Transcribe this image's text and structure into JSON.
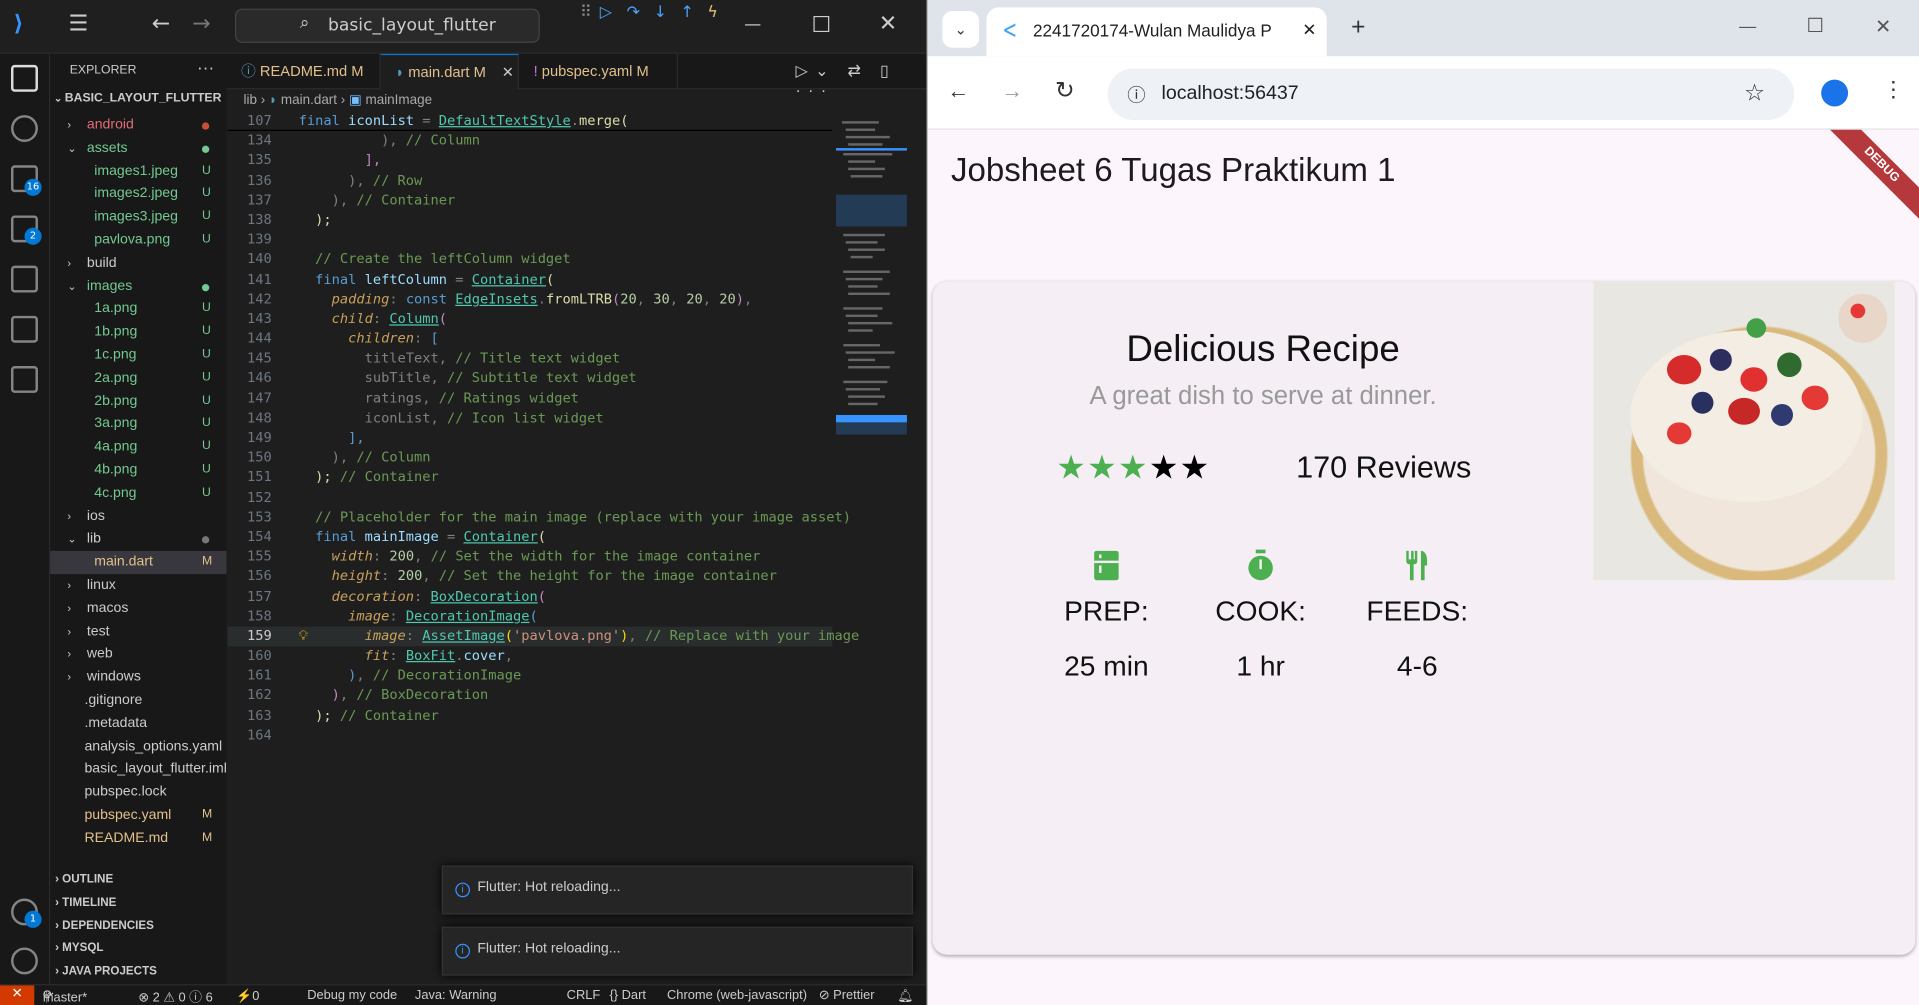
{
  "vscode": {
    "command_center": "basic_layout_flutter",
    "explorer_title": "EXPLORER",
    "project": "BASIC_LAYOUT_FLUTTER",
    "tree": [
      {
        "name": "android",
        "type": "folder",
        "open": false,
        "indent": 1,
        "status": "dot-red"
      },
      {
        "name": "assets",
        "type": "folder",
        "open": true,
        "indent": 1,
        "status": "dot-green"
      },
      {
        "name": "images1.jpeg",
        "type": "file",
        "indent": 2,
        "status": "U"
      },
      {
        "name": "images2.jpeg",
        "type": "file",
        "indent": 2,
        "status": "U"
      },
      {
        "name": "images3.jpeg",
        "type": "file",
        "indent": 2,
        "status": "U"
      },
      {
        "name": "pavlova.png",
        "type": "file",
        "indent": 2,
        "status": "U"
      },
      {
        "name": "build",
        "type": "folder",
        "open": false,
        "indent": 1,
        "status": ""
      },
      {
        "name": "images",
        "type": "folder",
        "open": true,
        "indent": 1,
        "status": "dot-green"
      },
      {
        "name": "1a.png",
        "type": "file",
        "indent": 2,
        "status": "U"
      },
      {
        "name": "1b.png",
        "type": "file",
        "indent": 2,
        "status": "U"
      },
      {
        "name": "1c.png",
        "type": "file",
        "indent": 2,
        "status": "U"
      },
      {
        "name": "2a.png",
        "type": "file",
        "indent": 2,
        "status": "U"
      },
      {
        "name": "2b.png",
        "type": "file",
        "indent": 2,
        "status": "U"
      },
      {
        "name": "3a.png",
        "type": "file",
        "indent": 2,
        "status": "U"
      },
      {
        "name": "4a.png",
        "type": "file",
        "indent": 2,
        "status": "U"
      },
      {
        "name": "4b.png",
        "type": "file",
        "indent": 2,
        "status": "U"
      },
      {
        "name": "4c.png",
        "type": "file",
        "indent": 2,
        "status": "U"
      },
      {
        "name": "ios",
        "type": "folder",
        "open": false,
        "indent": 1,
        "status": ""
      },
      {
        "name": "lib",
        "type": "folder",
        "open": true,
        "indent": 1,
        "status": "dot-gray"
      },
      {
        "name": "main.dart",
        "type": "file",
        "indent": 2,
        "status": "M",
        "selected": true
      },
      {
        "name": "linux",
        "type": "folder",
        "open": false,
        "indent": 1,
        "status": ""
      },
      {
        "name": "macos",
        "type": "folder",
        "open": false,
        "indent": 1,
        "status": ""
      },
      {
        "name": "test",
        "type": "folder",
        "open": false,
        "indent": 1,
        "status": ""
      },
      {
        "name": "web",
        "type": "folder",
        "open": false,
        "indent": 1,
        "status": ""
      },
      {
        "name": "windows",
        "type": "folder",
        "open": false,
        "indent": 1,
        "status": ""
      },
      {
        "name": ".gitignore",
        "type": "file",
        "indent": 1,
        "status": ""
      },
      {
        "name": ".metadata",
        "type": "file",
        "indent": 1,
        "status": ""
      },
      {
        "name": "analysis_options.yaml",
        "type": "file",
        "indent": 1,
        "status": ""
      },
      {
        "name": "basic_layout_flutter.iml",
        "type": "file",
        "indent": 1,
        "status": ""
      },
      {
        "name": "pubspec.lock",
        "type": "file",
        "indent": 1,
        "status": ""
      },
      {
        "name": "pubspec.yaml",
        "type": "file",
        "indent": 1,
        "status": "M"
      },
      {
        "name": "README.md",
        "type": "file",
        "indent": 1,
        "status": "M"
      }
    ],
    "sections": [
      "OUTLINE",
      "TIMELINE",
      "DEPENDENCIES",
      "MYSQL",
      "JAVA PROJECTS"
    ],
    "tabs": [
      {
        "label": "README.md",
        "mod": "M",
        "icon": "info-icon"
      },
      {
        "label": "main.dart",
        "mod": "M",
        "icon": "dart-icon",
        "active": true
      },
      {
        "label": "pubspec.yaml",
        "mod": "M",
        "icon": "yaml-icon"
      }
    ],
    "breadcrumb": {
      "a": "lib",
      "b": "main.dart",
      "c": "mainImage"
    },
    "code": [
      {
        "n": "107",
        "sticky": true,
        "parts": [
          [
            "k",
            "final "
          ],
          [
            "v",
            "iconList "
          ],
          [
            "g",
            "= "
          ],
          [
            "t",
            "DefaultTextStyle"
          ],
          [
            "g",
            "."
          ],
          [
            "f",
            "merge"
          ],
          [
            "y",
            "("
          ]
        ]
      },
      {
        "n": "134",
        "parts": [
          [
            "g",
            "          ), "
          ],
          [
            "c",
            "// Column"
          ]
        ]
      },
      {
        "n": "135",
        "parts": [
          [
            "g",
            "        "
          ],
          [
            "kc",
            "],"
          ]
        ]
      },
      {
        "n": "136",
        "parts": [
          [
            "g",
            "      ), "
          ],
          [
            "c",
            "// Row"
          ]
        ]
      },
      {
        "n": "137",
        "parts": [
          [
            "g",
            "    ), "
          ],
          [
            "c",
            "// Container"
          ]
        ]
      },
      {
        "n": "138",
        "parts": [
          [
            "y",
            "  );"
          ]
        ]
      },
      {
        "n": "139",
        "parts": []
      },
      {
        "n": "140",
        "parts": [
          [
            "c",
            "  // Create the leftColumn widget"
          ]
        ]
      },
      {
        "n": "141",
        "parts": [
          [
            "k",
            "  final "
          ],
          [
            "v",
            "leftColumn "
          ],
          [
            "g",
            "= "
          ],
          [
            "t",
            "Container"
          ],
          [
            "y",
            "("
          ]
        ]
      },
      {
        "n": "142",
        "parts": [
          [
            "it",
            "    padding"
          ],
          [
            "g",
            ": "
          ],
          [
            "k",
            "const "
          ],
          [
            "t",
            "EdgeInsets"
          ],
          [
            "g",
            "."
          ],
          [
            "f",
            "fromLTRB"
          ],
          [
            "kc",
            "("
          ],
          [
            "n",
            "20"
          ],
          [
            "g",
            ", "
          ],
          [
            "n",
            "30"
          ],
          [
            "g",
            ", "
          ],
          [
            "n",
            "20"
          ],
          [
            "g",
            ", "
          ],
          [
            "n",
            "20"
          ],
          [
            "kc",
            ")"
          ],
          [
            "g",
            ","
          ]
        ]
      },
      {
        "n": "143",
        "parts": [
          [
            "it",
            "    child"
          ],
          [
            "g",
            ": "
          ],
          [
            "t",
            "Column"
          ],
          [
            "kc",
            "("
          ]
        ]
      },
      {
        "n": "144",
        "parts": [
          [
            "it",
            "      children"
          ],
          [
            "g",
            ": "
          ],
          [
            "k",
            "["
          ]
        ]
      },
      {
        "n": "145",
        "parts": [
          [
            "g",
            "        titleText, "
          ],
          [
            "c",
            "// Title text widget"
          ]
        ]
      },
      {
        "n": "146",
        "parts": [
          [
            "g",
            "        subTitle, "
          ],
          [
            "c",
            "// Subtitle text widget"
          ]
        ]
      },
      {
        "n": "147",
        "parts": [
          [
            "g",
            "        ratings, "
          ],
          [
            "c",
            "// Ratings widget"
          ]
        ]
      },
      {
        "n": "148",
        "parts": [
          [
            "g",
            "        iconList, "
          ],
          [
            "c",
            "// Icon list widget"
          ]
        ]
      },
      {
        "n": "149",
        "parts": [
          [
            "k",
            "      ],"
          ]
        ]
      },
      {
        "n": "150",
        "parts": [
          [
            "g",
            "    ), "
          ],
          [
            "c",
            "// Column"
          ]
        ]
      },
      {
        "n": "151",
        "parts": [
          [
            "y",
            "  ); "
          ],
          [
            "c",
            "// Container"
          ]
        ]
      },
      {
        "n": "152",
        "parts": []
      },
      {
        "n": "153",
        "parts": [
          [
            "c",
            "  // Placeholder for the main image (replace with your image asset)"
          ]
        ]
      },
      {
        "n": "154",
        "parts": [
          [
            "k",
            "  final "
          ],
          [
            "v",
            "mainImage "
          ],
          [
            "g",
            "= "
          ],
          [
            "t",
            "Container"
          ],
          [
            "y",
            "("
          ]
        ]
      },
      {
        "n": "155",
        "parts": [
          [
            "it",
            "    width"
          ],
          [
            "g",
            ": "
          ],
          [
            "n",
            "200"
          ],
          [
            "g",
            ", "
          ],
          [
            "c",
            "// Set the width for the image container"
          ]
        ]
      },
      {
        "n": "156",
        "parts": [
          [
            "it",
            "    height"
          ],
          [
            "g",
            ": "
          ],
          [
            "n",
            "200"
          ],
          [
            "g",
            ", "
          ],
          [
            "c",
            "// Set the height for the image container"
          ]
        ]
      },
      {
        "n": "157",
        "parts": [
          [
            "it",
            "    decoration"
          ],
          [
            "g",
            ": "
          ],
          [
            "t",
            "BoxDecoration"
          ],
          [
            "kc",
            "("
          ]
        ]
      },
      {
        "n": "158",
        "parts": [
          [
            "it",
            "      image"
          ],
          [
            "g",
            ": "
          ],
          [
            "t",
            "DecorationImage"
          ],
          [
            "k",
            "("
          ]
        ]
      },
      {
        "n": "159",
        "cur": true,
        "parts": [
          [
            "it",
            "        image"
          ],
          [
            "g",
            ": "
          ],
          [
            "t",
            "AssetImage"
          ],
          [
            "pr",
            "("
          ],
          [
            "s",
            "'pavlova.png'"
          ],
          [
            "pr",
            ")"
          ],
          [
            "g",
            ", "
          ],
          [
            "c",
            "// Replace with your image"
          ]
        ]
      },
      {
        "n": "160",
        "parts": [
          [
            "it",
            "        fit"
          ],
          [
            "g",
            ": "
          ],
          [
            "t",
            "BoxFit"
          ],
          [
            "g",
            "."
          ],
          [
            "v",
            "cover"
          ],
          [
            "g",
            ","
          ]
        ]
      },
      {
        "n": "161",
        "parts": [
          [
            "k",
            "      )"
          ],
          [
            "g",
            ", "
          ],
          [
            "c",
            "// DecorationImage"
          ]
        ]
      },
      {
        "n": "162",
        "parts": [
          [
            "kc",
            "    )"
          ],
          [
            "g",
            ", "
          ],
          [
            "c",
            "// BoxDecoration"
          ]
        ]
      },
      {
        "n": "163",
        "parts": [
          [
            "y",
            "  ); "
          ],
          [
            "c",
            "// Container"
          ]
        ]
      },
      {
        "n": "164",
        "parts": []
      }
    ],
    "notifications": [
      "Flutter: Hot reloading...",
      "Flutter: Hot reloading..."
    ],
    "activity_badges": {
      "scm": "16",
      "debug": "2",
      "account": "1"
    },
    "status": {
      "branch": "master*",
      "problems": "⊗ 2 ⚠ 0 ⓘ 6",
      "ports": "⚡0",
      "debug": "Debug my code",
      "java": "Java: Warning",
      "eol": "CRLF",
      "lang": "{} Dart",
      "device": "Chrome (web-javascript)",
      "prettier": "⊘ Prettier"
    }
  },
  "chrome": {
    "tab_title": "2241720174-Wulan Maulidya P",
    "url": "localhost:56437"
  },
  "app": {
    "title": "Jobsheet 6 Tugas Praktikum 1",
    "debug_banner": "DEBUG",
    "recipe_title": "Delicious Recipe",
    "recipe_subtitle": "A great dish to serve at dinner.",
    "rating": {
      "filled": 3,
      "total": 5,
      "filled_color": "#4caf50",
      "empty_color": "#000000"
    },
    "reviews": "170 Reviews",
    "icons": [
      {
        "icon": "kitchen-icon",
        "label": "PREP:",
        "value": "25 min"
      },
      {
        "icon": "timer-icon",
        "label": "COOK:",
        "value": "1 hr"
      },
      {
        "icon": "restaurant-icon",
        "label": "FEEDS:",
        "value": "4-6"
      }
    ],
    "accent_green": "#4caf50"
  }
}
